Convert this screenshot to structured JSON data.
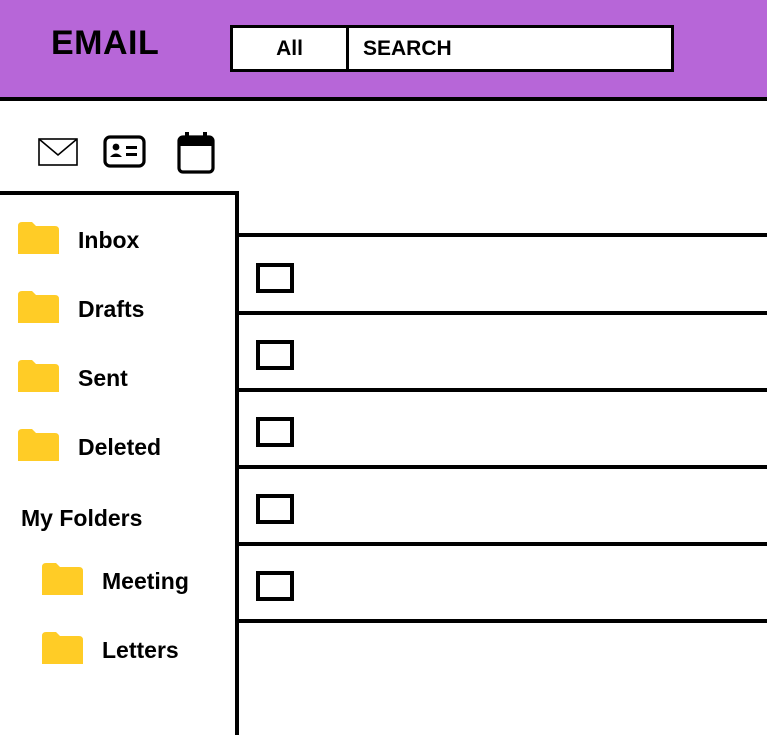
{
  "header": {
    "title": "EMAIL",
    "filter_label": "All",
    "search_placeholder": "SEARCH",
    "background": "#b766d8"
  },
  "toolbar": {
    "icons": [
      "mail-icon",
      "contacts-icon",
      "calendar-icon"
    ]
  },
  "sidebar": {
    "folders": [
      {
        "label": "Inbox"
      },
      {
        "label": "Drafts"
      },
      {
        "label": "Sent"
      },
      {
        "label": "Deleted"
      }
    ],
    "my_folders_title": "My Folders",
    "my_folders": [
      {
        "label": "Meeting"
      },
      {
        "label": "Letters"
      }
    ],
    "folder_color": "#ffcc26"
  },
  "mail_list": {
    "row_count": 5
  }
}
